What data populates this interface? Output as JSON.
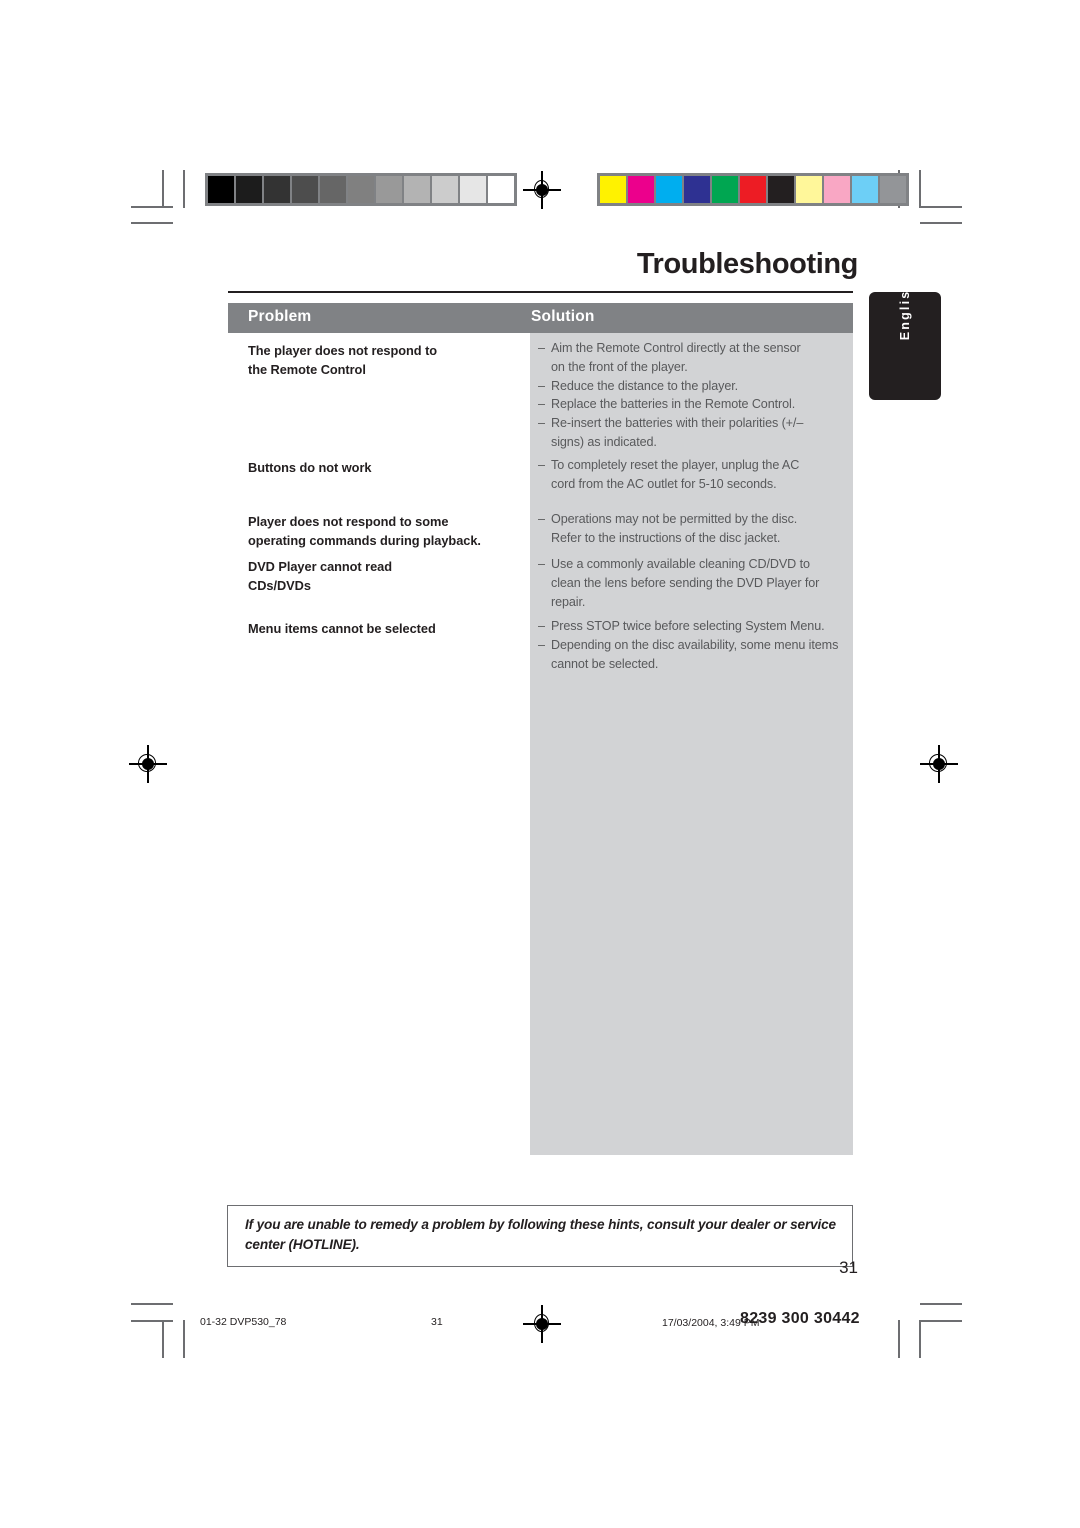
{
  "page": {
    "title": "Troubleshooting",
    "language_tab": "English",
    "page_number": "31"
  },
  "table": {
    "headers": {
      "problem": "Problem",
      "solution": "Solution"
    },
    "problems": [
      {
        "id": "remote-control",
        "text": "The player does not respond to\nthe Remote Control"
      },
      {
        "id": "buttons",
        "text": "Buttons do not work"
      },
      {
        "id": "operating-commands",
        "text": "Player does not respond to some\noperating commands during playback."
      },
      {
        "id": "cannot-read-discs",
        "text": "DVD Player cannot read\nCDs/DVDs"
      },
      {
        "id": "menu-items",
        "text": "Menu items cannot be selected"
      }
    ],
    "solutions": [
      {
        "id": "remote-control",
        "lines": [
          "Aim the Remote Control directly at the sensor",
          "on the front of the player.",
          "Reduce the distance to the player.",
          "Replace the batteries in the Remote Control.",
          "Re-insert the batteries with their polarities (+/–",
          "signs) as indicated."
        ],
        "bullets": [
          true,
          false,
          true,
          true,
          true,
          false
        ]
      },
      {
        "id": "buttons",
        "lines": [
          "To completely reset the player, unplug the AC",
          "cord from the AC outlet for 5-10 seconds."
        ],
        "bullets": [
          true,
          false
        ]
      },
      {
        "id": "operating-commands",
        "lines": [
          "Operations may not be permitted by the disc.",
          "Refer to the instructions of  the disc jacket."
        ],
        "bullets": [
          true,
          false
        ]
      },
      {
        "id": "cannot-read-discs",
        "lines": [
          "Use a commonly available cleaning CD/DVD to",
          "clean the lens before sending the DVD Player for",
          "repair."
        ],
        "bullets": [
          true,
          false,
          false
        ]
      },
      {
        "id": "menu-items",
        "lines": [
          "Press STOP twice before selecting System Menu.",
          "Depending on the disc availability, some menu items",
          "cannot be selected."
        ],
        "bullets": [
          true,
          true,
          false
        ]
      }
    ],
    "bullet_dash": "–"
  },
  "note": {
    "text": "If you are unable to remedy a problem by following these hints, consult your dealer or service center (HOTLINE)."
  },
  "footer": {
    "file_label": "01-32 DVP530_78",
    "page_label": "31",
    "date_label": "17/03/2004, 3:49 PM",
    "part_number": "8239 300  30442"
  },
  "calibration": {
    "grayscale": [
      "#000000",
      "#1c1c1c",
      "#333333",
      "#4d4d4d",
      "#666666",
      "#808080",
      "#999999",
      "#b3b3b3",
      "#cccccc",
      "#e6e6e6",
      "#ffffff"
    ],
    "colors": [
      "#fff200",
      "#ec008c",
      "#00aeef",
      "#2e3192",
      "#00a651",
      "#ed1c24",
      "#231f20",
      "#fff79a",
      "#f9a7c4",
      "#6dcff6",
      "#939598"
    ]
  },
  "colors": {
    "header_gray": "#808285",
    "panel_gray": "#d2d3d5",
    "body_text": "#58595b",
    "dark_text": "#231f20",
    "mark_gray": "#6d6e71"
  }
}
